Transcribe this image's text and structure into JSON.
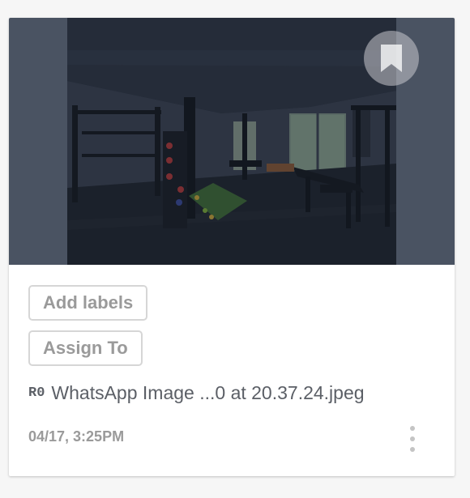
{
  "card": {
    "add_labels": "Add labels",
    "assign_to": "Assign To",
    "revision": "R0",
    "file_name": "WhatsApp Image ...0 at 20.37.24.jpeg",
    "timestamp": "04/17, 3:25PM"
  },
  "icons": {
    "bookmark": "bookmark-icon",
    "more": "more-vertical-icon"
  },
  "colors": {
    "thumb_background": "#4a5362",
    "chip_border": "#d6d6d6",
    "muted_text": "#9a9a9a",
    "body_text": "#5b5f66"
  }
}
